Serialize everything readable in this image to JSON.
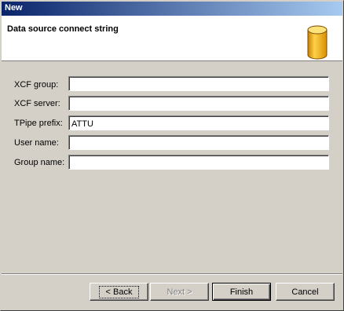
{
  "window": {
    "title": "New"
  },
  "banner": {
    "title": "Data source connect string",
    "icon": "database-cylinder-icon",
    "icon_color": "#f5b21b"
  },
  "form": {
    "fields": [
      {
        "label": "XCF group:",
        "value": ""
      },
      {
        "label": "XCF server:",
        "value": ""
      },
      {
        "label": "TPipe prefix:",
        "value": "ATTU"
      },
      {
        "label": "User name:",
        "value": ""
      },
      {
        "label": "Group name:",
        "value": ""
      }
    ]
  },
  "buttons": {
    "back": "< Back",
    "next": "Next >",
    "finish": "Finish",
    "cancel": "Cancel"
  }
}
